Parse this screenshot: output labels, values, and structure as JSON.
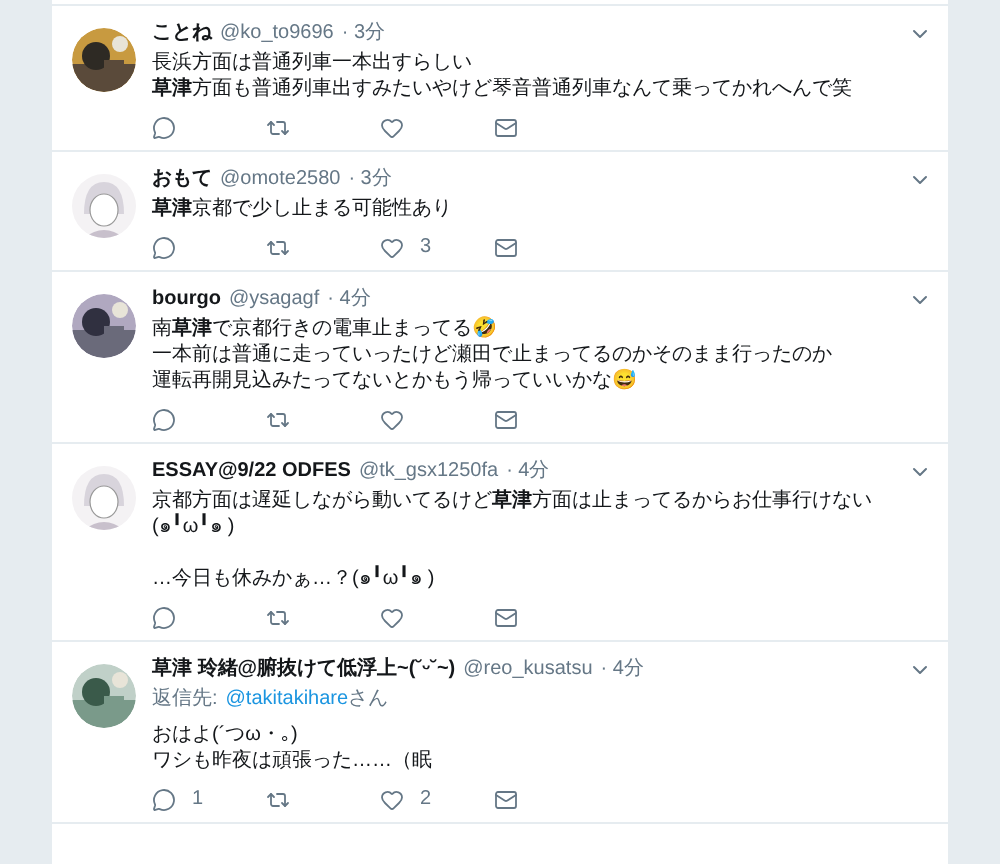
{
  "tweets": [
    {
      "name": "ことね",
      "handle": "@ko_to9696",
      "time": "· 3分",
      "paragraphs": [
        [
          "長浜方面は普通列車一本出すらしい",
          "**草津**方面も普通列車出すみたいやけど琴音普通列車なんて乗ってかれへんで笑"
        ]
      ]
    },
    {
      "name": "おもて",
      "handle": "@omote2580",
      "time": "· 3分",
      "paragraphs": [
        [
          "**草津**京都で少し止まる可能性あり"
        ]
      ],
      "likes": "3"
    },
    {
      "name": "bourgo",
      "handle": "@ysagagf",
      "time": "· 4分",
      "paragraphs": [
        [
          "南**草津**で京都行きの電車止まってる🤣",
          "一本前は普通に走っていったけど瀬田で止まってるのかそのまま行ったのか",
          "運転再開見込みたってないとかもう帰っていいかな😅"
        ]
      ]
    },
    {
      "name": "ESSAY@9/22 ODFES",
      "handle": "@tk_gsx1250fa",
      "time": "· 4分",
      "paragraphs": [
        [
          "京都方面は遅延しながら動いてるけど**草津**方面は止まってるからお仕事行けない(๑╹ω╹๑ )"
        ],
        [
          "…今日も休みかぁ…？(๑╹ω╹๑ )"
        ]
      ]
    },
    {
      "name": "草津 玲緒@腑抜けて低浮上~(˘ᵕ˘~)",
      "handle": "@reo_kusatsu",
      "time": "· 4分",
      "reply_label": "返信先:",
      "reply_to": "@takitakihare",
      "reply_suffix": "さん",
      "paragraphs": [
        [
          "おはよ(´つω・｡)",
          "ワシも昨夜は頑張った……（眠"
        ]
      ],
      "replies": "1",
      "likes": "2"
    }
  ]
}
